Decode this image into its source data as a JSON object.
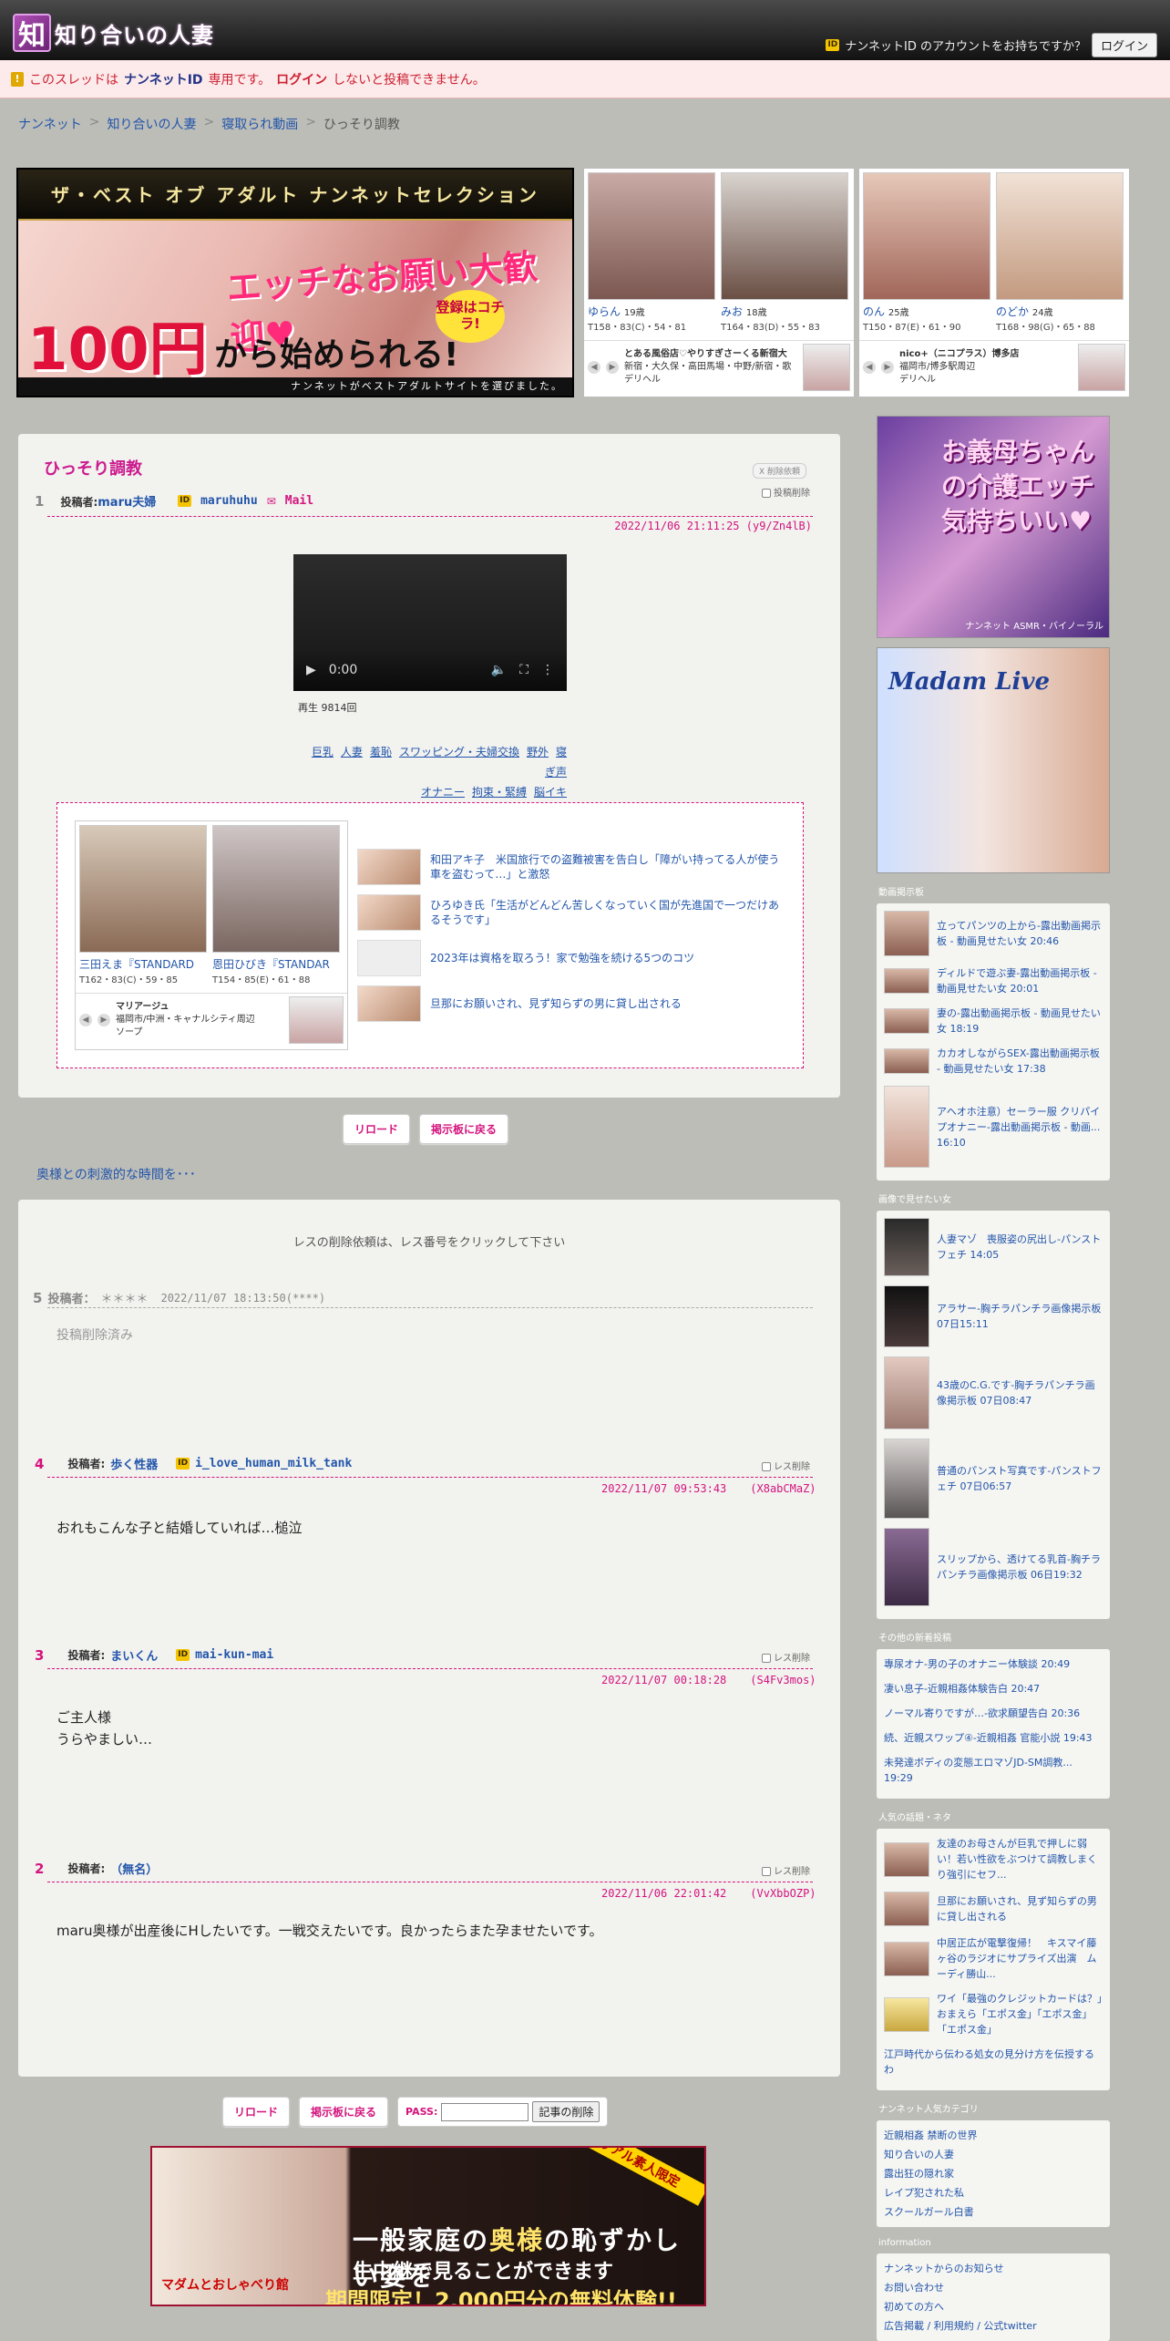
{
  "header": {
    "logo_text": "知り合いの人妻",
    "account_prompt": "ナンネットID のアカウントをお持ちですか？",
    "login_label": "ログイン"
  },
  "notice": {
    "pre": "このスレッドは",
    "id_name": "ナンネットID",
    "mid": "専用です。",
    "login_link": "ログイン",
    "post": "しないと投稿できません。"
  },
  "breadcrumb": [
    "ナンネット",
    "知り合いの人妻",
    "寝取られ動画",
    "ひっそり調教"
  ],
  "top_banner": {
    "headline": "ザ・ベスト オブ アダルト ナンネットセレクション",
    "pink": "エッチなお願い大歓迎♥",
    "big": "100円",
    "big2": "から始められる!",
    "cta": "登録はコチラ!",
    "foot": "ナンネットがベストアダルトサイトを選びました。"
  },
  "girls_left": [
    {
      "name": "ゆらん",
      "age": "19歳",
      "size": "T158・83(C)・54・81"
    },
    {
      "name": "みお",
      "age": "18歳",
      "size": "T164・83(D)・55・83"
    }
  ],
  "shop_left": {
    "title": "とある風俗店♡やりすぎさーくる新宿大",
    "area": "新宿・大久保・高田馬場・中野/新宿・歌",
    "type": "デリヘル"
  },
  "girls_right": [
    {
      "name": "のん",
      "age": "25歳",
      "size": "T150・87(E)・61・90"
    },
    {
      "name": "のどか",
      "age": "24歳",
      "size": "T168・98(G)・65・88"
    }
  ],
  "shop_right": {
    "title": "nico+（ニコプラス）博多店",
    "area": "福岡市/博多駅周辺",
    "type": "デリヘル"
  },
  "thread": {
    "title": "ひっそり調教",
    "x_share": "X 削除依頼",
    "post1": {
      "no": "1",
      "label": "投稿者:",
      "author": "maru夫婦",
      "id": "maruhuhu",
      "mail": "Mail",
      "del": "投稿削除",
      "date": "2022/11/06 21:11:25 (y9/Zn4lB)",
      "video_time": "0:00",
      "plays": "再生 9814回",
      "tags": [
        "巨乳",
        "人妻",
        "羞恥",
        "スワッピング・夫婦交換",
        "野外",
        "寝ぎ声",
        "オナニー",
        "拘束・緊縛",
        "脳イキ"
      ]
    }
  },
  "ad_girls": [
    {
      "name": "三田えま『STANDARD",
      "size": "T162・83(C)・59・85"
    },
    {
      "name": "恩田ひびき『STANDAR",
      "size": "T154・85(E)・61・88"
    }
  ],
  "ad_shop": {
    "title": "マリアージュ",
    "area": "福岡市/中洲・キャナルシティ周辺",
    "type": "ソープ"
  },
  "news": [
    "和田アキ子　米国旅行での盗難被害を告白し「障がい持ってる人が使う車を盗むって…」と激怒",
    "ひろゆき氏「生活がどんどん苦しくなっていく国が先進国で一つだけあるそうです」",
    "2023年は資格を取ろう！家で勉強を続ける5つのコツ",
    "旦那にお願いされ、見ず知らずの男に貸し出される"
  ],
  "buttons": {
    "reload": "リロード",
    "back": "掲示板に戻る",
    "pass": "PASS:",
    "delete": "記事の削除"
  },
  "hook": "奥様との刺激的な時間を･･･",
  "delete_note": "レスの削除依頼は、レス番号をクリックして下さい",
  "replies": [
    {
      "no": "5",
      "label": "投稿者：",
      "author": "＊＊＊＊",
      "date": "2022/11/07 18:13:50(****)",
      "body": "投稿削除済み"
    },
    {
      "no": "4",
      "label": "投稿者:",
      "author": "歩く性器",
      "id": "i_love_human_milk_tank",
      "del": "レス削除",
      "date": "2022/11/07 09:53:43",
      "hash": "(X8abCMaZ)",
      "body": "おれもこんな子と結婚していれば…槌泣"
    },
    {
      "no": "3",
      "label": "投稿者:",
      "author": "まいくん",
      "id": "mai-kun-mai",
      "del": "レス削除",
      "date": "2022/11/07 00:18:28",
      "hash": "(S4Fv3mos)",
      "body1": "ご主人様",
      "body2": "うらやましい…"
    },
    {
      "no": "2",
      "label": "投稿者:",
      "author": "（無名）",
      "del": "レス削除",
      "date": "2022/11/06 22:01:42",
      "hash": "(VvXbbOZP)",
      "body": "maru奥様が出産後にHしたいです。一戦交えたいです。良かったらまた孕ませたいです。"
    }
  ],
  "bottom_banner": {
    "line1a": "一般家庭の",
    "line1b": "奥様",
    "line1c": "の恥ずかしい姿を",
    "line2": "生中継で見ることができます",
    "line3": "期間限定！2,000円分の無料体験!!",
    "ribbon": "リアル素人限定",
    "brand": "マダムとおしゃべり館"
  },
  "sidebar": {
    "banner1": "お義母ちゃんの介護エッチ気持ちいい♥",
    "banner1_foot": "ナンネット ASMR・バイノーラル",
    "banner2": "Madam Live",
    "sec_video": "動画掲示板",
    "video_items": [
      "立ってパンツの上から-露出動画掲示板 - 動画見せたい女 20:46",
      "ディルドで遊ぶ妻-露出動画掲示板 - 動画見せたい女 20:01",
      "妻の-露出動画掲示板 - 動画見せたい女 18:19",
      "カカオしながらSEX-露出動画掲示板 - 動画見せたい女 17:38",
      "アヘオホ注意）セーラー服 クリパイプオナニー-露出動画掲示板 - 動画... 16:10"
    ],
    "sec_image": "画像で見せたい女",
    "image_items": [
      "人妻マゾ　喪服姿の尻出し-パンストフェチ 14:05",
      "アラサー-胸チラパンチラ画像掲示板 07日15:11",
      "43歳のC.G.です-胸チラパンチラ画像掲示板 07日08:47",
      "普通のパンスト写真です-パンストフェチ 07日06:57",
      "スリップから、透けてる乳首-胸チラパンチラ画像掲示板 06日19:32"
    ],
    "sec_new": "その他の新着投稿",
    "new_items": [
      "專尿オナ-男の子のオナニー体験談 20:49",
      "凄い息子-近親相姦体験告白 20:47",
      "ノーマル寄りですが…-欲求願望告白 20:36",
      "続、近親スワップ④-近親相姦 官能小説 19:43",
      "未発達ボディの変態エロマゾJD-SM調教... 19:29"
    ],
    "sec_topic": "人気の話題・ネタ",
    "topic_items": [
      "友達のお母さんが巨乳で押しに弱い！若い性欲をぶつけて調教しまくり強引にセフ...",
      "旦那にお願いされ、見ず知らずの男に貸し出される",
      "中居正広が電撃復帰！　キスマイ藤ヶ谷のラジオにサプライズ出演　ムーディ勝山...",
      "ワイ「最強のクレジットカードは？」おまえら「エポス金」「エポス金」「エポス金」"
    ],
    "topic_last": "江戸時代から伝わる処女の見分け方を伝授するわ",
    "sec_cat": "ナンネット人気カテゴリ",
    "cat_items": [
      "近親相姦 禁断の世界",
      "知り合いの人妻",
      "露出狂の隠れ家",
      "レイプ犯された私",
      "スクールガール白書"
    ],
    "sec_info": "information",
    "info_items": [
      "ナンネットからのお知らせ",
      "お問い合わせ",
      "初めての方へ",
      "広告掲載 / 利用規約 / 公式twitter"
    ]
  }
}
